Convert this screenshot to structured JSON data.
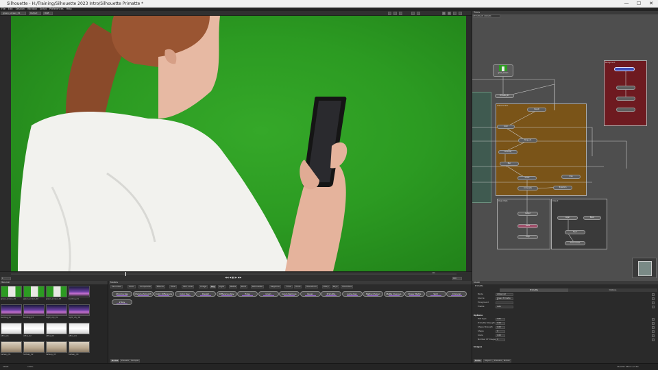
{
  "window": {
    "title": "Silhouette - H:/Training/Silhouette 2023 Intro/Silhouette Primatte *",
    "controls": [
      "—",
      "☐",
      "✕"
    ]
  },
  "menu": [
    "File",
    "Edit",
    "Session",
    "Window",
    "Script",
    "Preferences",
    "Help"
  ],
  "viewer": {
    "session_select": "green_screen_01",
    "view_mode": "Output",
    "channel": "RGB"
  },
  "timeline": {
    "playback": "◀◀ ◀ ▮▮ ▶ ▶▶",
    "frame_start": "1",
    "frame_end": "100",
    "zoom": "100"
  },
  "source_panel": {
    "title": "Source",
    "thumbnails": [
      {
        "label": "green_screen_01",
        "kind": "woman"
      },
      {
        "label": "green_screen_02",
        "kind": "woman"
      },
      {
        "label": "green_screen_03",
        "kind": "woman"
      },
      {
        "label": "building_01",
        "kind": "city"
      },
      {
        "label": "building_02",
        "kind": "city"
      },
      {
        "label": "building_03",
        "kind": "city"
      },
      {
        "label": "night_city_01",
        "kind": "city"
      },
      {
        "label": "night_city_02",
        "kind": "city"
      },
      {
        "label": "office_01",
        "kind": "white"
      },
      {
        "label": "office_02",
        "kind": "white"
      },
      {
        "label": "office_03",
        "kind": "white"
      },
      {
        "label": "office_04",
        "kind": "white"
      },
      {
        "label": "hallway_01",
        "kind": "room"
      },
      {
        "label": "hallway_02",
        "kind": "room"
      },
      {
        "label": "hallway_03",
        "kind": "room"
      },
      {
        "label": "hallway_04",
        "kind": "room"
      }
    ]
  },
  "nodes_panel": {
    "title": "Nodes",
    "tabs": [
      "Favorites",
      "Color",
      "Composite",
      "Effects",
      "Filter",
      "Film Look",
      "Image",
      "Key",
      "Light",
      "Matte",
      "Paint",
      "Silhouette",
      "Sapphire",
      "Time",
      "Tools",
      "Transform",
      "Warp",
      "Keys",
      "Favorites"
    ],
    "active_tab": "Key",
    "buttons": [
      "Chroma Key",
      "Chroma Smooth",
      "Color Difference",
      "Color Key",
      "Despill",
      "Difference Key",
      "Edge",
      "Grain",
      "Grain Remove",
      "Keyer",
      "Primatte",
      "Luma Key",
      "Matte Choker",
      "Matte Cleanup",
      "Power Matte",
      "Spill",
      "Channel",
      "Z Key"
    ],
    "footer_tabs": [
      "Nodes",
      "Presets",
      "Sample"
    ]
  },
  "tree_panel": {
    "title": "Trees",
    "tree_select": "Primatte_01 (default)",
    "groups": [
      {
        "label": "Green Screen",
        "color": "#7a5418"
      },
      {
        "label": "Background",
        "color": "#6e1a20"
      },
      {
        "label": "Clean Plate",
        "color": "#4c4c4c"
      },
      {
        "label": "Output",
        "color": "#3a3a3a"
      }
    ],
    "nodes": [
      "green_screen",
      "Primatte_01",
      "Despill",
      "Color",
      "Merge_01",
      "Luma Key",
      "Blur",
      "Grade",
      "Composite",
      "Transform",
      "Crop",
      "Output",
      "Matte",
      "Edge",
      "Layer",
      "Blend",
      "Keyer",
      "Color Correct"
    ]
  },
  "node_panel": {
    "title": "Node",
    "node_label": "Primatte",
    "tabs": [
      "Primatte",
      "Options"
    ],
    "fields": [
      {
        "label": "Mode",
        "value": "Advanced"
      },
      {
        "label": "Source",
        "value": "Green Primatte 1"
      },
      {
        "label": "Foreground",
        "value": ""
      },
      {
        "label": "Enable",
        "value": "Auto"
      }
    ],
    "section_options": "Options",
    "option_fields": [
      {
        "label": "Mat Type",
        "value": "Auto"
      },
      {
        "label": "Primatte Strength",
        "value": "1.00"
      },
      {
        "label": "Shape Strength",
        "value": "1.00"
      },
      {
        "label": "Shape",
        "value": "0"
      },
      {
        "label": "Scale",
        "value": "1.00"
      },
      {
        "label": "Number Of Images",
        "value": "0"
      }
    ],
    "section_images": "Images",
    "footer_tabs": [
      "Node",
      "Object",
      "Presets",
      "Notes"
    ]
  },
  "statusbar": {
    "text": "SRGB",
    "zoom": "100%",
    "right_text": "4K/UHD 3840 x 2160"
  },
  "colors": {
    "greenscreen": "#2c9b22",
    "accent": "#3d4db8",
    "group_orange": "#7a5418",
    "group_red": "#6e1a20"
  }
}
